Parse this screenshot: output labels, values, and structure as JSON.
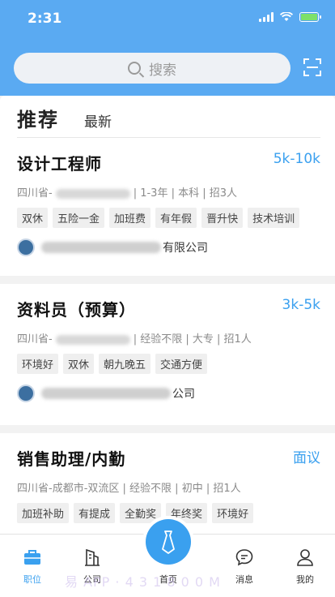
{
  "status": {
    "time": "2:31",
    "battery_color": "#7de06a"
  },
  "header": {
    "search_placeholder": "搜索",
    "icons": [
      "search-icon",
      "scan-icon"
    ]
  },
  "tabs": {
    "recommended": "推荐",
    "latest": "最新"
  },
  "jobs": [
    {
      "title": "设计工程师",
      "salary": "5k-10k",
      "location": "四川省-",
      "meta": "| 1-3年 | 本科 | 招3人",
      "tags": [
        "双休",
        "五险一金",
        "加班费",
        "有年假",
        "晋升快",
        "技术培训"
      ],
      "company": "有限公司"
    },
    {
      "title": "资料员（预算）",
      "salary": "3k-5k",
      "location": "四川省-",
      "meta": "| 经验不限 | 大专 | 招1人",
      "tags": [
        "环境好",
        "双休",
        "朝九晚五",
        "交通方便"
      ],
      "company": "公司"
    },
    {
      "title": "销售助理/内勤",
      "salary": "面议",
      "location": "四川省-成都市-双流区",
      "meta": "| 经验不限 | 初中 | 招1人",
      "tags": [
        "加班补助",
        "有提成",
        "全勤奖",
        "年终奖",
        "环境好"
      ],
      "company": ""
    }
  ],
  "tabbar": {
    "jobs": "职位",
    "company": "公司",
    "home": "首页",
    "messages": "消息",
    "mine": "我的"
  },
  "watermark": "易 APP · 4 3 1 8 0 0 M",
  "accent": "#3aa0ef",
  "header_color": "#5aaaf2"
}
